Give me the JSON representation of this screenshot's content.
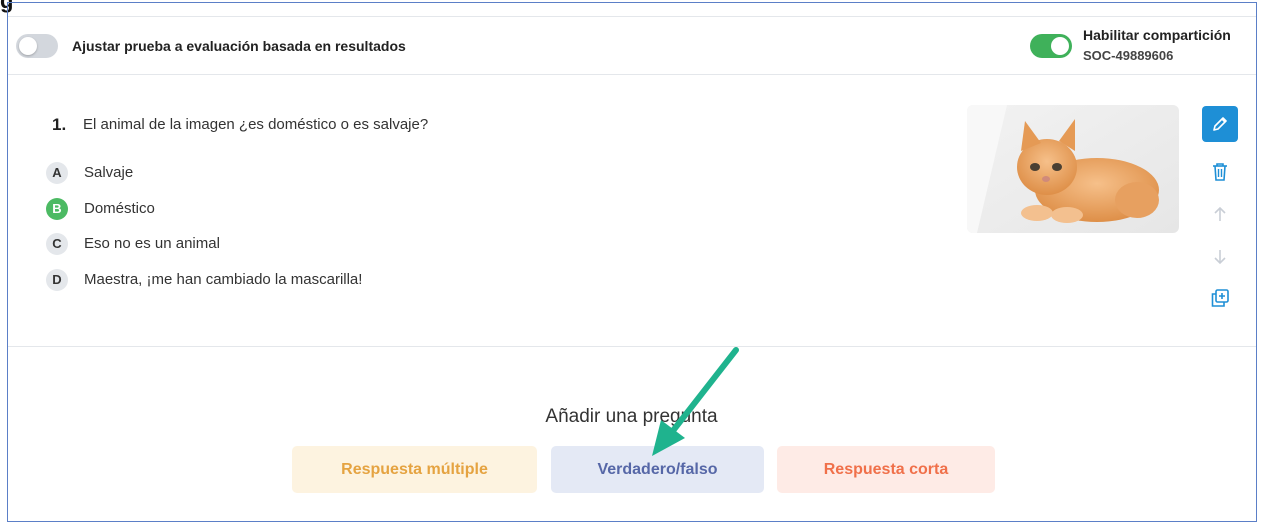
{
  "header": {
    "clipped_title": "g"
  },
  "settings": {
    "adjust_toggle_label": "Ajustar prueba a evaluación basada en resultados",
    "adjust_toggle_on": false,
    "share_toggle_label": "Habilitar compartición",
    "share_code": "SOC-49889606",
    "share_toggle_on": true
  },
  "question": {
    "number": "1.",
    "text": "El animal de la imagen ¿es doméstico o es salvaje?",
    "image_icon": "kitten-photo",
    "options": [
      {
        "letter": "A",
        "text": "Salvaje",
        "correct": false
      },
      {
        "letter": "B",
        "text": "Doméstico",
        "correct": true
      },
      {
        "letter": "C",
        "text": "Eso no es un animal",
        "correct": false
      },
      {
        "letter": "D",
        "text": "Maestra, ¡me han cambiado la mascarilla!",
        "correct": false
      }
    ],
    "actions": [
      "pencil-icon",
      "trash-icon",
      "arrow-up-icon",
      "arrow-down-icon",
      "duplicate-icon"
    ]
  },
  "add_question": {
    "title": "Añadir una pregunta",
    "buttons": {
      "multiple_choice": "Respuesta múltiple",
      "true_false": "Verdadero/falso",
      "short_answer": "Respuesta corta"
    }
  },
  "colors": {
    "accent_blue": "#1e8fd6",
    "correct_green": "#4cba63",
    "toggle_green": "#3fb15a",
    "annotation_arrow": "#1fb38e"
  }
}
